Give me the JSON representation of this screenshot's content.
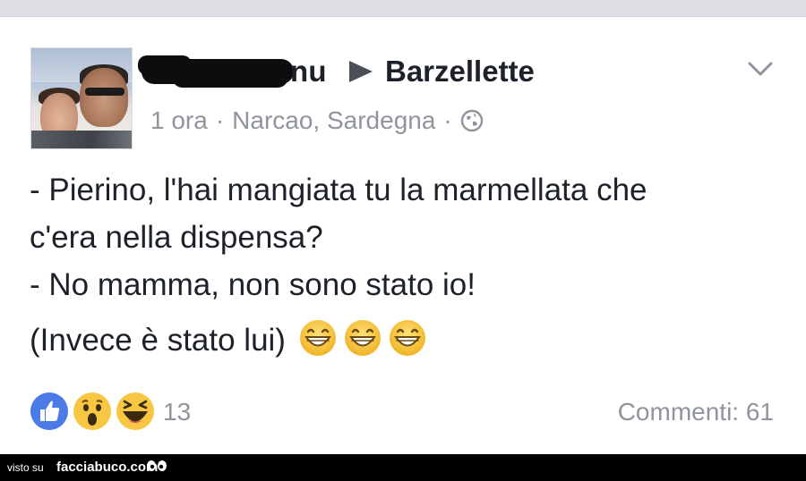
{
  "post": {
    "author_suffix": "nu",
    "group_name": "Barzellette",
    "time": "1 ora",
    "separator": "·",
    "location": "Narcao, Sardegna",
    "privacy_icon": "globe-icon",
    "text_lines": [
      "- Pierino, l'hai mangiata tu la marmellata che",
      "c'era nella dispensa?",
      "- No mamma, non sono stato io!",
      "(Invece è stato lui)"
    ],
    "emojis": [
      "grinning-face",
      "grinning-face",
      "grinning-face"
    ]
  },
  "reactions": {
    "icons": [
      "like-icon",
      "wow-icon",
      "haha-icon"
    ],
    "count": "13"
  },
  "comments": {
    "label": "Commenti: 61"
  },
  "footer": {
    "visto": "visto su",
    "brand": "facciabuco.com"
  },
  "colors": {
    "text": "#1d2129",
    "meta": "#90949c",
    "like_blue": "#4267b2",
    "emoji_yellow": "#f7c744"
  }
}
